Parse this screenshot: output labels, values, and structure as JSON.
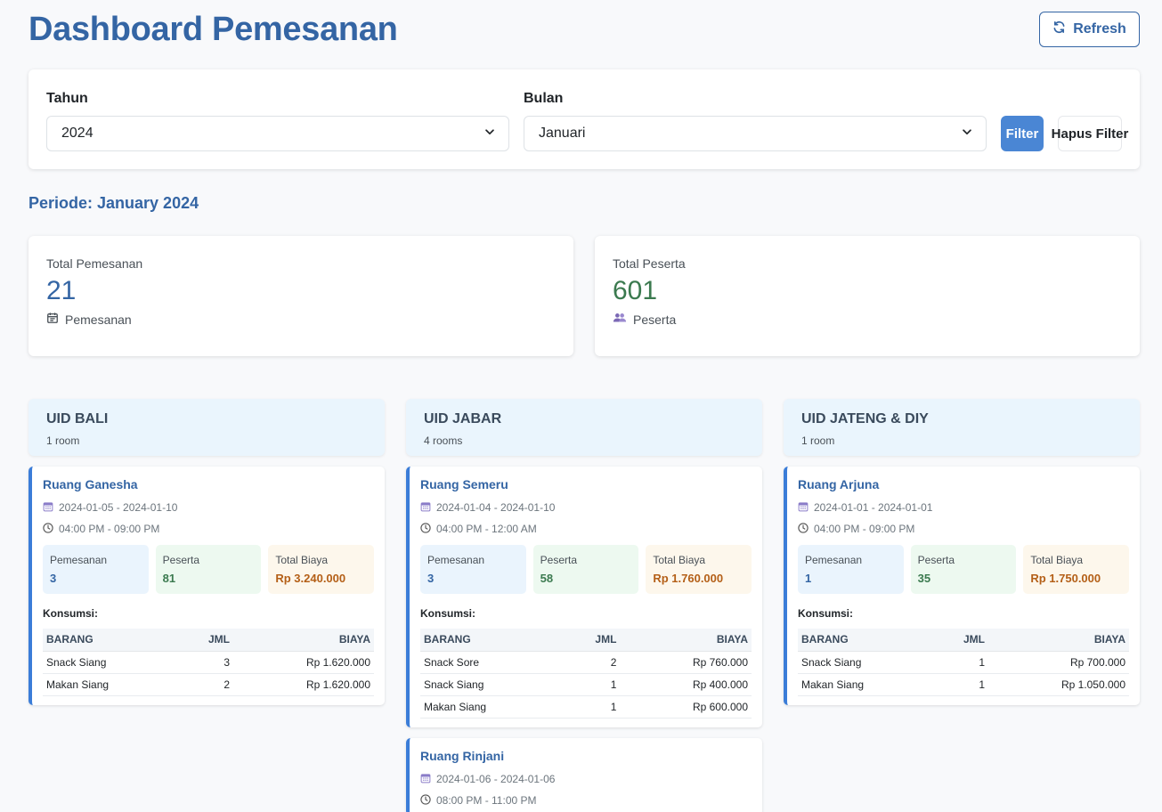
{
  "header": {
    "title": "Dashboard Pemesanan",
    "refresh_label": "Refresh"
  },
  "filter": {
    "year_label": "Tahun",
    "year_value": "2024",
    "month_label": "Bulan",
    "month_value": "Januari",
    "filter_button": "Filter",
    "clear_button": "Hapus Filter"
  },
  "periode": "Periode: January 2024",
  "stats": {
    "total_pemesanan": {
      "label": "Total Pemesanan",
      "value": "21",
      "sub": "Pemesanan",
      "color": "#3465a4"
    },
    "total_peserta": {
      "label": "Total Peserta",
      "value": "601",
      "sub": "Peserta",
      "color": "#3b7a4f"
    }
  },
  "regions": [
    {
      "name": "UID BALI",
      "count": "1 room",
      "rooms": [
        {
          "name": "Ruang Ganesha",
          "dates": "2024-01-05 - 2024-01-10",
          "time": "04:00 PM - 09:00 PM",
          "pemesanan_label": "Pemesanan",
          "pemesanan": "3",
          "peserta_label": "Peserta",
          "peserta": "81",
          "biaya_label": "Total Biaya",
          "biaya": "Rp 3.240.000",
          "konsumsi_label": "Konsumsi:",
          "headers": [
            "BARANG",
            "JML",
            "BIAYA"
          ],
          "items": [
            {
              "barang": "Snack Siang",
              "jml": "3",
              "biaya": "Rp 1.620.000"
            },
            {
              "barang": "Makan Siang",
              "jml": "2",
              "biaya": "Rp 1.620.000"
            }
          ]
        }
      ]
    },
    {
      "name": "UID JABAR",
      "count": "4 rooms",
      "rooms": [
        {
          "name": "Ruang Semeru",
          "dates": "2024-01-04 - 2024-01-10",
          "time": "04:00 PM - 12:00 AM",
          "pemesanan_label": "Pemesanan",
          "pemesanan": "3",
          "peserta_label": "Peserta",
          "peserta": "58",
          "biaya_label": "Total Biaya",
          "biaya": "Rp 1.760.000",
          "konsumsi_label": "Konsumsi:",
          "headers": [
            "BARANG",
            "JML",
            "BIAYA"
          ],
          "items": [
            {
              "barang": "Snack Sore",
              "jml": "2",
              "biaya": "Rp 760.000"
            },
            {
              "barang": "Snack Siang",
              "jml": "1",
              "biaya": "Rp 400.000"
            },
            {
              "barang": "Makan Siang",
              "jml": "1",
              "biaya": "Rp 600.000"
            }
          ]
        },
        {
          "name": "Ruang Rinjani",
          "dates": "2024-01-06 - 2024-01-06",
          "time": "08:00 PM - 11:00 PM"
        }
      ]
    },
    {
      "name": "UID JATENG & DIY",
      "count": "1 room",
      "rooms": [
        {
          "name": "Ruang Arjuna",
          "dates": "2024-01-01 - 2024-01-01",
          "time": "04:00 PM - 09:00 PM",
          "pemesanan_label": "Pemesanan",
          "pemesanan": "1",
          "peserta_label": "Peserta",
          "peserta": "35",
          "biaya_label": "Total Biaya",
          "biaya": "Rp 1.750.000",
          "konsumsi_label": "Konsumsi:",
          "headers": [
            "BARANG",
            "JML",
            "BIAYA"
          ],
          "items": [
            {
              "barang": "Snack Siang",
              "jml": "1",
              "biaya": "Rp 700.000"
            },
            {
              "barang": "Makan Siang",
              "jml": "1",
              "biaya": "Rp 1.050.000"
            }
          ]
        }
      ]
    }
  ]
}
